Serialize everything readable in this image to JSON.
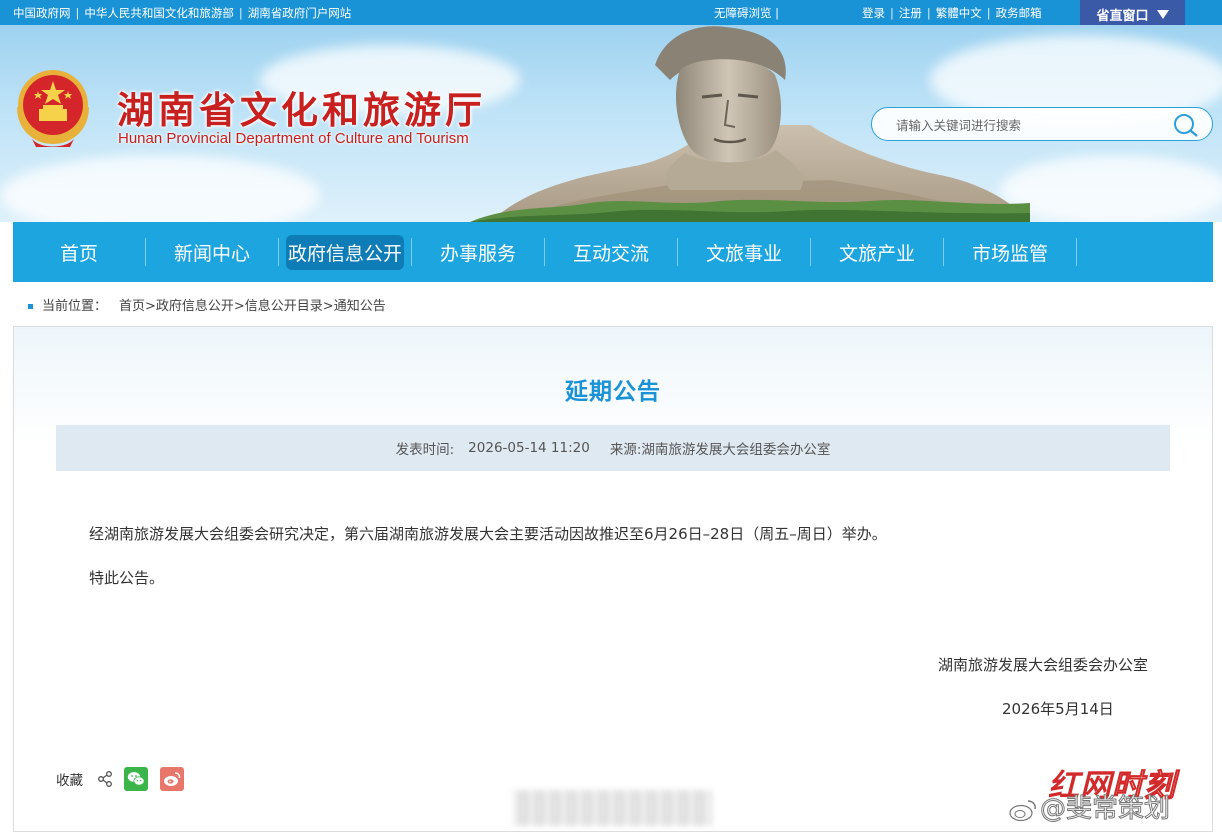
{
  "topbar": {
    "links": [
      "中国政府网",
      "中华人民共和国文化和旅游部",
      "湖南省政府门户网站"
    ],
    "accessible": "无障碍浏览",
    "accessible_sep": "|",
    "right_links": [
      "登录",
      "注册",
      "繁體中文",
      "政务邮箱"
    ],
    "window_button": "省直窗口"
  },
  "header": {
    "title": "湖南省文化和旅游厅",
    "subtitle": "Hunan Provincial Department of Culture and Tourism",
    "search_placeholder": "请输入关键词进行搜索"
  },
  "nav": {
    "items": [
      "首页",
      "新闻中心",
      "政府信息公开",
      "办事服务",
      "互动交流",
      "文旅事业",
      "文旅产业",
      "市场监管"
    ],
    "active_index": 2
  },
  "breadcrumb": {
    "label": "当前位置：",
    "path": "首页>政府信息公开>信息公开目录>通知公告"
  },
  "article": {
    "title": "延期公告",
    "publish_label": "发表时间:",
    "publish_time": "2026-05-14 11:20",
    "source": "来源:湖南旅游发展大会组委会办公室",
    "paragraphs": [
      "经湖南旅游发展大会组委会研究决定，第六届湖南旅游发展大会主要活动因故推迟至6月26日–28日（周五–周日）举办。",
      "特此公告。"
    ],
    "signature_org": "湖南旅游发展大会组委会办公室",
    "signature_date": "2026年5月14日"
  },
  "share": {
    "label": "收藏"
  },
  "watermark": {
    "logo_a": "红网",
    "logo_b": "时刻",
    "handle": "@斐常策划"
  },
  "colors": {
    "topbar": "#1a93d6",
    "nav": "#1ca5df",
    "nav_active": "#0e7cb6",
    "title_red": "#c8201f",
    "article_title": "#1a93d6"
  }
}
